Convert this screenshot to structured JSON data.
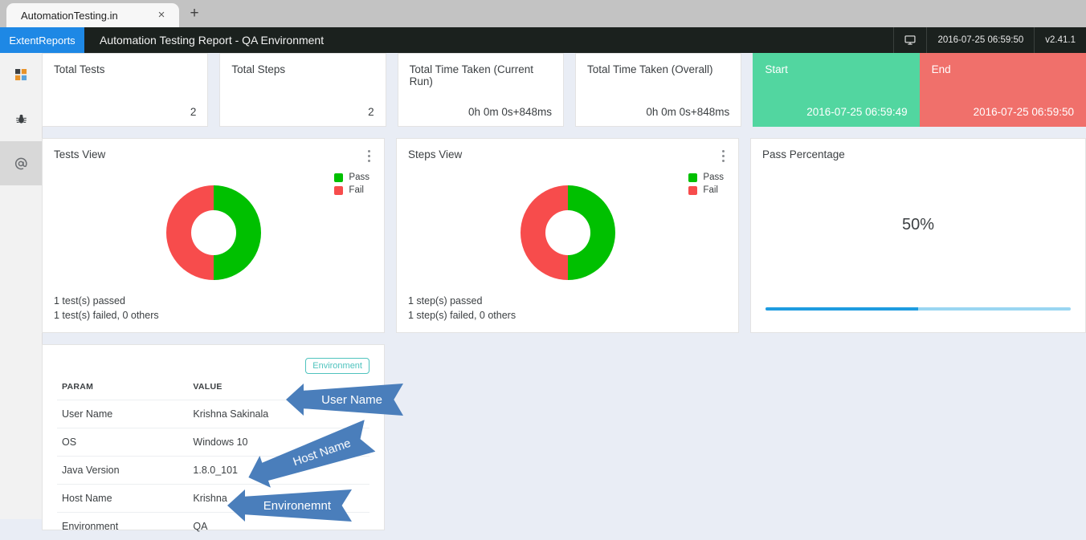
{
  "browser": {
    "tab_title": "AutomationTesting.in",
    "close_label": "×",
    "newtab_label": "+"
  },
  "header": {
    "brand": "ExtentReports",
    "report_title": "Automation Testing Report - QA Environment",
    "timestamp": "2016-07-25 06:59:50",
    "version": "v2.41.1",
    "monitor_icon": "monitor-icon"
  },
  "sidebar": {
    "items": [
      {
        "name": "dashboard",
        "icon": "dashboard-grid-icon",
        "active": false
      },
      {
        "name": "exceptions",
        "icon": "bug-icon",
        "active": false
      },
      {
        "name": "tests",
        "icon": "at-symbol-icon",
        "active": true
      }
    ]
  },
  "kpis": [
    {
      "label": "Total Tests",
      "value": "2",
      "style": "plain"
    },
    {
      "label": "Total Steps",
      "value": "2",
      "style": "plain"
    },
    {
      "label": "Total Time Taken (Current Run)",
      "value": "0h 0m 0s+848ms",
      "style": "plain"
    },
    {
      "label": "Total Time Taken (Overall)",
      "value": "0h 0m 0s+848ms",
      "style": "plain"
    },
    {
      "label": "Start",
      "value": "2016-07-25 06:59:49",
      "style": "green"
    },
    {
      "label": "End",
      "value": "2016-07-25 06:59:50",
      "style": "red"
    }
  ],
  "panels": {
    "tests_view": {
      "title": "Tests View",
      "legend": [
        {
          "label": "Pass",
          "color": "#00c000"
        },
        {
          "label": "Fail",
          "color": "#f74c4c"
        }
      ],
      "foot_line1": "1 test(s) passed",
      "foot_line2": "1 test(s) failed, 0 others"
    },
    "steps_view": {
      "title": "Steps View",
      "legend": [
        {
          "label": "Pass",
          "color": "#00c000"
        },
        {
          "label": "Fail",
          "color": "#f74c4c"
        }
      ],
      "foot_line1": "1 step(s) passed",
      "foot_line2": "1 step(s) failed, 0 others"
    },
    "pass_percentage": {
      "title": "Pass Percentage",
      "value": "50%",
      "progress": 50,
      "bar_color": "#1e9ce0",
      "bar_track_color": "#9ad6f2"
    }
  },
  "environment": {
    "badge": "Environment",
    "columns": [
      "PARAM",
      "VALUE"
    ],
    "rows": [
      {
        "param": "User Name",
        "value": "Krishna Sakinala"
      },
      {
        "param": "OS",
        "value": "Windows 10"
      },
      {
        "param": "Java Version",
        "value": "1.8.0_101"
      },
      {
        "param": "Host Name",
        "value": "Krishna"
      },
      {
        "param": "Environment",
        "value": "QA"
      }
    ]
  },
  "annotations": [
    {
      "label": "User Name",
      "color": "#4a7ebb"
    },
    {
      "label": "Host Name",
      "color": "#4a7ebb"
    },
    {
      "label": "Environemnt",
      "color": "#4a7ebb"
    }
  ],
  "chart_data": [
    {
      "type": "pie",
      "title": "Tests View",
      "labels": [
        "Pass",
        "Fail"
      ],
      "values": [
        1,
        1
      ],
      "percentages": [
        50,
        50
      ],
      "colors": [
        "#00c000",
        "#f74c4c"
      ],
      "donut": true,
      "legend_position": "top-right",
      "annotations": [
        "1 test(s) passed",
        "1 test(s) failed, 0 others"
      ]
    },
    {
      "type": "pie",
      "title": "Steps View",
      "labels": [
        "Pass",
        "Fail"
      ],
      "values": [
        1,
        1
      ],
      "percentages": [
        50,
        50
      ],
      "colors": [
        "#00c000",
        "#f74c4c"
      ],
      "donut": true,
      "legend_position": "top-right",
      "annotations": [
        "1 step(s) passed",
        "1 step(s) failed, 0 others"
      ]
    },
    {
      "type": "bar",
      "title": "Pass Percentage",
      "categories": [
        "Pass Percentage"
      ],
      "values": [
        50
      ],
      "ylim": [
        0,
        100
      ],
      "ylabel": "%",
      "xlabel": "",
      "grid": false,
      "colors": [
        "#1e9ce0"
      ],
      "annotations": [
        "50%"
      ]
    }
  ]
}
